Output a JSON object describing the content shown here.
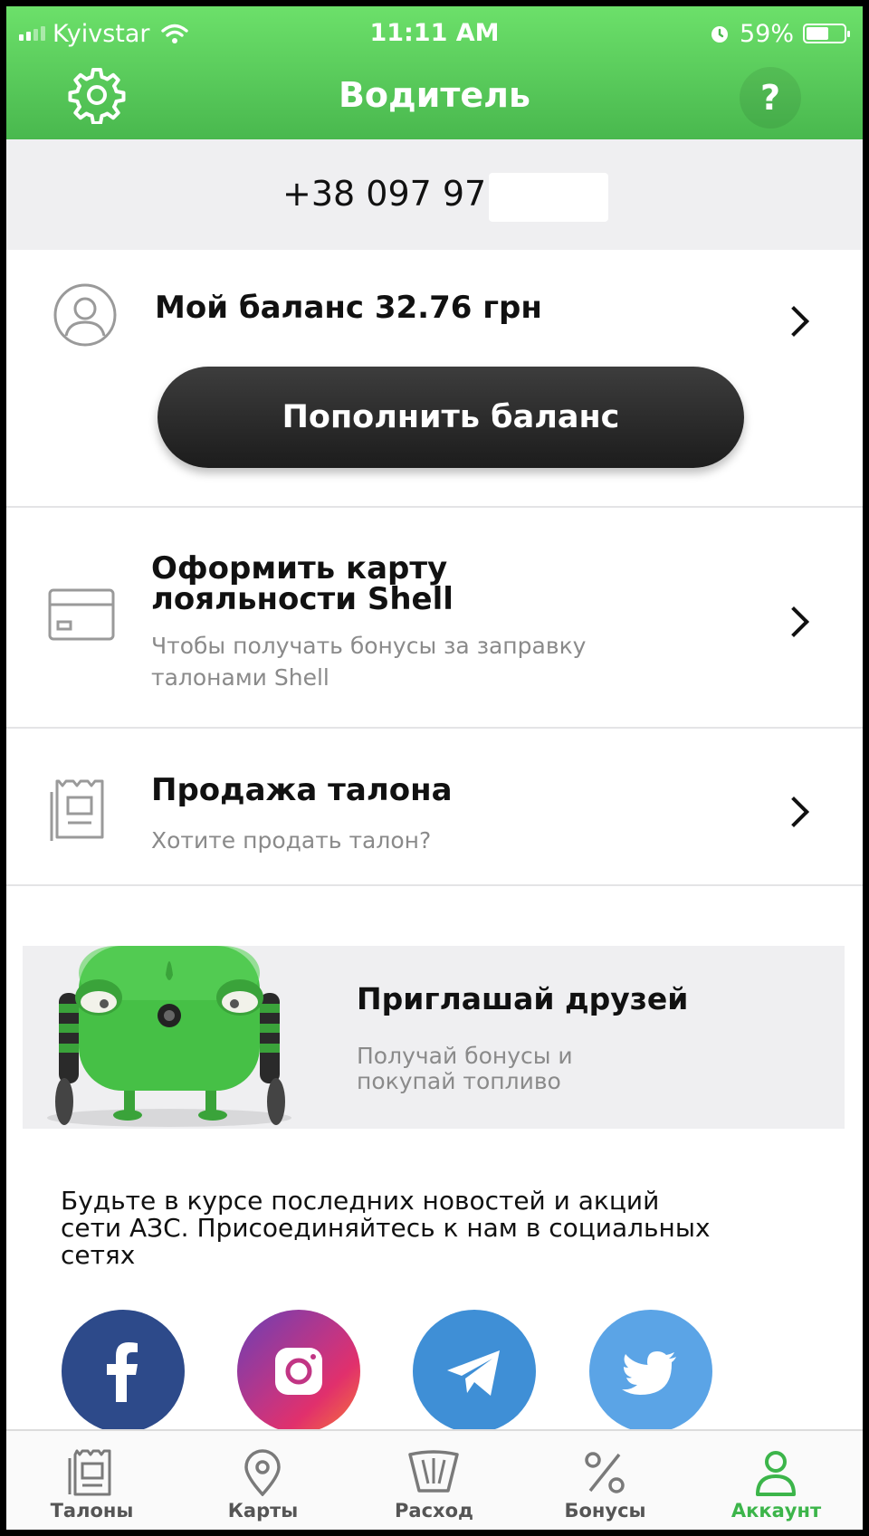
{
  "status_bar": {
    "carrier": "Kyivstar",
    "time": "11:11 AM",
    "battery": "59%",
    "battery_level": 0.59,
    "icons": [
      "signal-icon",
      "wifi-icon",
      "alarm-icon",
      "battery-icon"
    ]
  },
  "header": {
    "title": "Водитель",
    "help_label": "?",
    "settings_icon": "gear-icon"
  },
  "account": {
    "phone": "+38 097 971"
  },
  "balance": {
    "label": "Мой баланс 32.76 грн",
    "topup_label": "Пополнить баланс"
  },
  "loyalty": {
    "title_line1": "Оформить карту",
    "title_line2": "лояльности Shell",
    "subtitle_line1": "Чтобы получать бонусы за заправку",
    "subtitle_line2": "талонами Shell"
  },
  "sell": {
    "title": "Продажа талона",
    "subtitle": "Хотите продать талон?"
  },
  "invite": {
    "title": "Приглашай друзей",
    "subtitle_line1": "Получай бонусы и",
    "subtitle_line2": "покупай топливо"
  },
  "news": {
    "line1": "Будьте в курсе последних новостей и акций",
    "line2": "сети АЗС. Присоединяйтесь к нам в социальных",
    "line3": "сетях"
  },
  "social": [
    {
      "icon": "facebook-icon",
      "color": "#2d4a8a"
    },
    {
      "icon": "instagram-icon",
      "color": "#c13584"
    },
    {
      "icon": "telegram-icon",
      "color": "#3f8fd6"
    },
    {
      "icon": "twitter-icon",
      "color": "#5ba4e6"
    }
  ],
  "tabs": [
    {
      "label": "Талоны",
      "icon": "coupon-icon"
    },
    {
      "label": "Карты",
      "icon": "map-pin-icon"
    },
    {
      "label": "Расход",
      "icon": "gauge-icon"
    },
    {
      "label": "Бонусы",
      "icon": "percent-icon"
    },
    {
      "label": "Аккаунт",
      "icon": "user-icon",
      "active": true
    }
  ],
  "colors": {
    "accent": "#3cb54a",
    "header_top": "#6ce06a",
    "header_bottom": "#49b84e",
    "button": "#2a2a2a"
  }
}
